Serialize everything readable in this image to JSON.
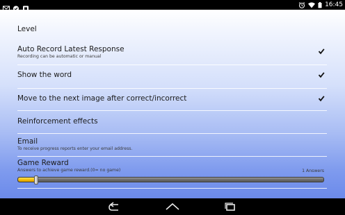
{
  "status_bar": {
    "time": "16:45",
    "left_icons": [
      "gmail-icon",
      "download-done-icon",
      "app-icon"
    ],
    "right_icons": [
      "alarm-icon",
      "wifi-icon",
      "battery-icon"
    ]
  },
  "settings": {
    "level": {
      "title": "Level"
    },
    "auto_record": {
      "title": "Auto Record Latest Response",
      "summary": "Recording can be automatic or manual",
      "checked": true
    },
    "show_word": {
      "title": "Show the word",
      "checked": true
    },
    "next_image": {
      "title": "Move to the next image after correct/incorrect",
      "checked": true
    },
    "reinforcement": {
      "title": "Reinforcement effects"
    },
    "email": {
      "title": "Email",
      "summary": "To receive progress reports enter your email address."
    },
    "game_reward": {
      "title": "Game Reward",
      "summary": "Answers to achieve game reward.(0= no game)",
      "value_label": "1 Answers",
      "value_fraction": 0.06
    }
  },
  "nav_bar": {
    "buttons": [
      "back-icon",
      "home-icon",
      "recents-icon"
    ]
  },
  "colors": {
    "slider_fill": "#f2b800",
    "gradient_top": "#ffffff",
    "gradient_bottom": "#6b8aeb"
  }
}
